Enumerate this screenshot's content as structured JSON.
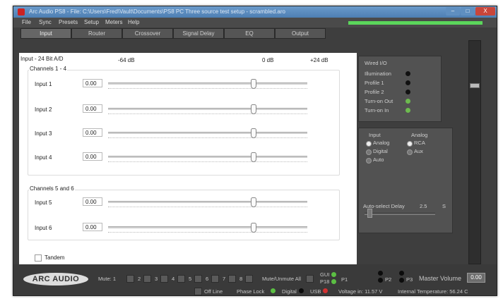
{
  "window": {
    "title": "Arc Audio PS8 - File: C:\\Users\\Fred\\Vault\\Documents\\PS8 PC Three source test setup - scrambled.aro",
    "buttons": {
      "minimize": "–",
      "maximize": "□",
      "close": "X"
    }
  },
  "menu": {
    "items": [
      "File",
      "Sync",
      "Presets",
      "Setup",
      "Meters",
      "Help"
    ]
  },
  "progress": {
    "value": 1.0,
    "color": "#5bd65b"
  },
  "tabs": [
    "Input",
    "Router",
    "Crossover",
    "Signal Delay",
    "EQ",
    "Output"
  ],
  "panel": {
    "header": {
      "title": "Input - 24 Bit A/D",
      "scale_low": "-64 dB",
      "scale_mid": "0 dB",
      "scale_high": "+24 dB"
    },
    "group1": {
      "label": "Channels 1 - 4",
      "rows": [
        {
          "label": "Input 1",
          "value": "0.00"
        },
        {
          "label": "Input 2",
          "value": "0.00"
        },
        {
          "label": "Input 3",
          "value": "0.00"
        },
        {
          "label": "Input 4",
          "value": "0.00"
        }
      ]
    },
    "group2": {
      "label": "Channels 5 and 6",
      "rows": [
        {
          "label": "Input 5",
          "value": "0.00"
        },
        {
          "label": "Input 6",
          "value": "0.00"
        }
      ]
    },
    "tandem_label": "Tandem",
    "slider_level": 0.727
  },
  "wired_io": {
    "title": "Wired I/O",
    "items": [
      {
        "label": "Illumination",
        "state": "off"
      },
      {
        "label": "Profile 1",
        "state": "off"
      },
      {
        "label": "Profile 2",
        "state": "off"
      },
      {
        "label": "Turn-on Out",
        "state": "on"
      },
      {
        "label": "Turn-on In",
        "state": "on"
      }
    ],
    "colors": {
      "off": "#111111",
      "on": "#6dbb4f"
    }
  },
  "input_select": {
    "col1_title": "Input",
    "col2_title": "Analog",
    "col1_options": [
      {
        "label": "Analog",
        "selected": true
      },
      {
        "label": "Digital",
        "selected": false
      },
      {
        "label": "Auto",
        "selected": false
      }
    ],
    "col2_options": [
      {
        "label": "RCA",
        "selected": true
      },
      {
        "label": "Aux",
        "selected": false
      }
    ],
    "autoselect_label": "Auto-select Delay",
    "autoselect_value": "2.5",
    "autoselect_unit": "S"
  },
  "bottom": {
    "logo": "ARC AUDIO",
    "mute_label": "Mute: 1",
    "mute_channels": [
      "2",
      "3",
      "4",
      "5",
      "6",
      "7",
      "8"
    ],
    "mute_unmute_all": "Mute/Unmute All",
    "gui_label": "GUI",
    "p18_label": "P18",
    "p1": "P1",
    "p2": "P2",
    "p3": "P3",
    "master_volume_label": "Master Volume",
    "master_volume_value": "0.00",
    "offline": "Off Line",
    "phase_lock": "Phase Lock",
    "digital": "Digital",
    "usb": "USB",
    "voltage": "Voltage in: 11.57 V",
    "temperature": "Internal Temperature: 56.24 C",
    "colors": {
      "green": "#5bbf43",
      "red": "#d23131",
      "black": "#0c0c0c"
    }
  }
}
